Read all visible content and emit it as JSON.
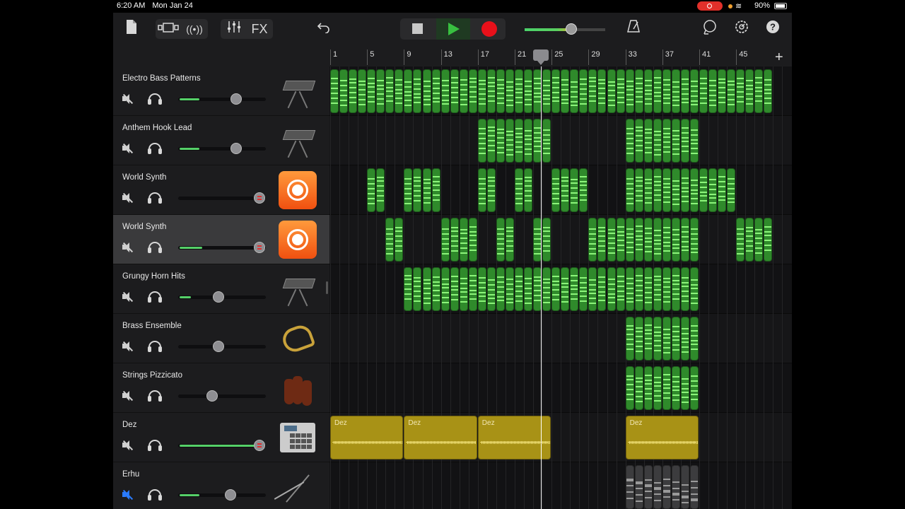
{
  "status_bar": {
    "time": "6:20 AM",
    "date": "Mon Jan 24",
    "battery": "90%"
  },
  "toolbar": {
    "fx_label": "FX",
    "icons": [
      "my-songs-icon",
      "browser-icon",
      "live-loops-icon",
      "mixer-icon",
      "undo-icon",
      "stop-icon",
      "play-icon",
      "record-icon",
      "metronome-icon",
      "loop-browser-icon",
      "settings-icon",
      "help-icon"
    ],
    "colors": {
      "play": "#38c040",
      "record": "#e8101a",
      "midi_region": "#2f8a2b",
      "audio_region": "#a89216"
    }
  },
  "master_volume": {
    "level": 0.58
  },
  "ruler": {
    "bars": [
      "1",
      "5",
      "9",
      "13",
      "17",
      "21",
      "25",
      "29",
      "33",
      "37",
      "41",
      "45"
    ],
    "playhead_bar": 23
  },
  "tracks": [
    {
      "name": "Electro Bass Patterns",
      "muted": false,
      "volume": 0.66,
      "instrument": "synth-keyboard-icon",
      "selected": false
    },
    {
      "name": "Anthem Hook Lead",
      "muted": false,
      "volume": 0.66,
      "instrument": "synth-keyboard-icon",
      "selected": false
    },
    {
      "name": "World Synth",
      "muted": false,
      "volume": 0.93,
      "instrument": "world-synth-icon",
      "selected": false
    },
    {
      "name": "World Synth",
      "muted": false,
      "volume": 0.93,
      "instrument": "world-synth-icon",
      "selected": true
    },
    {
      "name": "Grungy Horn Hits",
      "muted": false,
      "volume": 0.46,
      "instrument": "synth-keyboard-icon",
      "selected": false
    },
    {
      "name": "Brass Ensemble",
      "muted": false,
      "volume": 0.46,
      "instrument": "brass-icon",
      "selected": false
    },
    {
      "name": "Strings Pizzicato",
      "muted": false,
      "volume": 0.39,
      "instrument": "strings-icon",
      "selected": false
    },
    {
      "name": "Dez",
      "muted": false,
      "volume": 0.93,
      "instrument": "drum-machine-icon",
      "selected": false
    },
    {
      "name": "Erhu",
      "muted": true,
      "volume": 0.6,
      "instrument": "erhu-icon",
      "selected": false
    }
  ],
  "audio_regions": [
    "Dez",
    "Dez",
    "Dez",
    "Dez"
  ]
}
